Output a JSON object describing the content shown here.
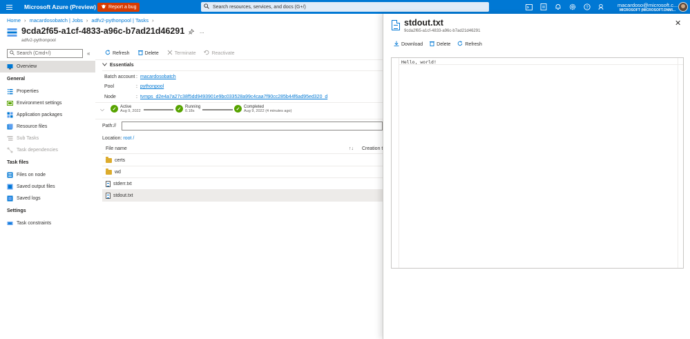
{
  "topbar": {
    "brand": "Microsoft Azure (Preview)",
    "report_bug": "Report a bug",
    "search_placeholder": "Search resources, services, and docs (G+/)",
    "account_email": "macardoso@microsoft.c...",
    "account_tenant": "MICROSOFT (MICROSOFT.ONMI...",
    "icons": [
      "cloud-shell-icon",
      "directory-icon",
      "notifications-icon",
      "settings-icon",
      "help-icon",
      "feedback-icon"
    ]
  },
  "breadcrumb": [
    "Home",
    "macardosobatch | Jobs",
    "adfv2-pythonpool | Tasks"
  ],
  "page": {
    "title": "9cda2f65-a1cf-4833-a96c-b7ad21d46291",
    "subtitle": "adfv2-pythonpool",
    "more": "..."
  },
  "sidebar": {
    "search_placeholder": "Search (Cmd+/)",
    "collapse": "«",
    "overview": "Overview",
    "sections": [
      {
        "title": "General",
        "items": [
          "Properties",
          "Environment settings",
          "Application packages",
          "Resource files",
          "Sub Tasks",
          "Task dependencies"
        ]
      },
      {
        "title": "Task files",
        "items": [
          "Files on node",
          "Saved output files",
          "Saved logs"
        ]
      },
      {
        "title": "Settings",
        "items": [
          "Task constraints"
        ]
      }
    ]
  },
  "toolbar": {
    "refresh": "Refresh",
    "delete": "Delete",
    "terminate": "Terminate",
    "reactivate": "Reactivate"
  },
  "essentials": {
    "label": "Essentials",
    "batch_account_label": "Batch account",
    "batch_account_value": "macardosobatch",
    "pool_label": "Pool",
    "pool_value": "pythonpool",
    "node_label": "Node",
    "node_value": "tvmps_d2e4a7a27c38f5dd9493901e9bc033528a99c4caa7f90cc285b44f6ad95ed320_d",
    "colon": ":"
  },
  "progress": {
    "chevron": "⌵",
    "steps": [
      {
        "name": "Active",
        "sub": "Aug 9, 2022"
      },
      {
        "name": "Running",
        "sub": "0.18s"
      },
      {
        "name": "Completed",
        "sub": "Aug 9, 2022 (4 minutes ago)"
      }
    ]
  },
  "files": {
    "path_label": "Path://",
    "location_label": "Location:",
    "location_value": "root /",
    "col_name": "File name",
    "col_sort": "↑↓",
    "col_created": "Creation t",
    "rows": [
      {
        "name": "certs",
        "type": "folder"
      },
      {
        "name": "wd",
        "type": "folder"
      },
      {
        "name": "stderr.txt",
        "type": "file"
      },
      {
        "name": "stdout.txt",
        "type": "file"
      }
    ]
  },
  "panel": {
    "title": "stdout.txt",
    "subtitle": "9cda2f65-a1cf-4833-a96c-b7ad21d46291",
    "close": "✕",
    "download": "Download",
    "delete": "Delete",
    "refresh": "Refresh",
    "content": "Hello, world!"
  },
  "colors": {
    "accent": "#0078d4",
    "bug": "#d83b01",
    "success": "#57a300"
  }
}
